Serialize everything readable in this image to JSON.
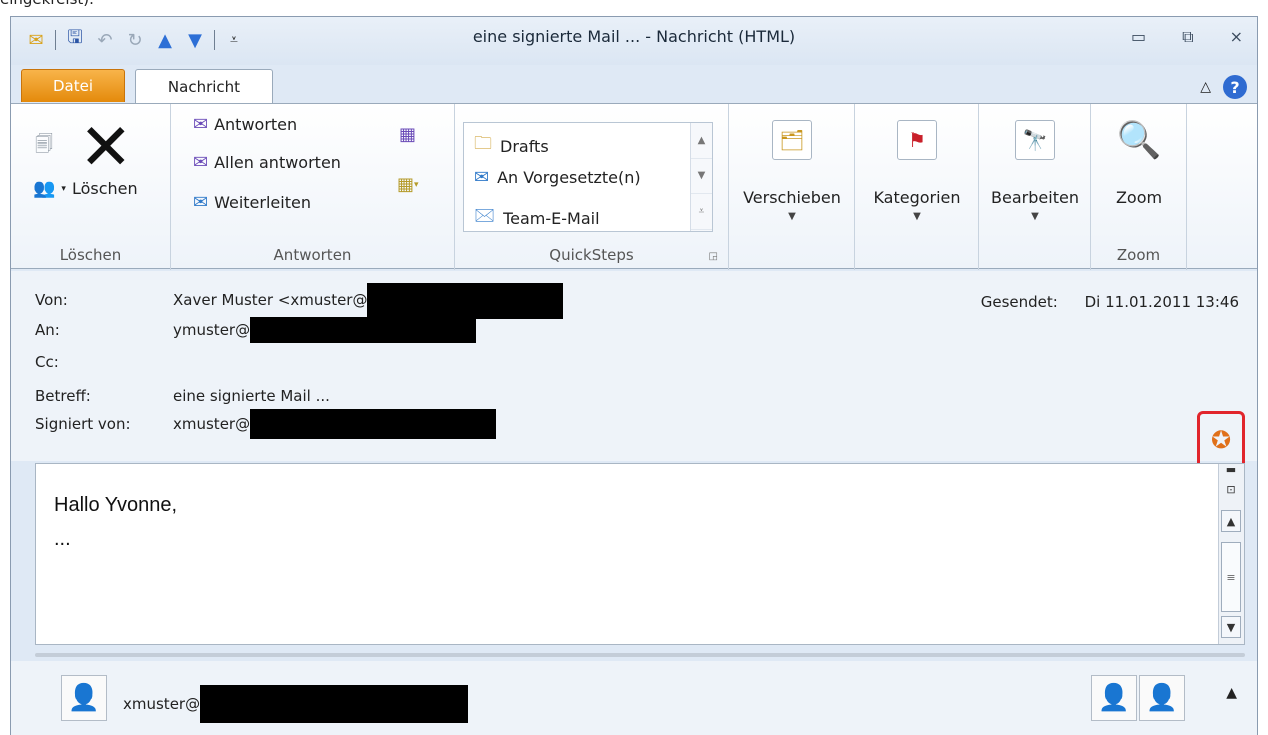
{
  "top_crop_text": "eingekreist).",
  "window": {
    "title": "eine signierte Mail ... - Nachricht (HTML)",
    "controls": {
      "minimize_icon": "minimize-icon",
      "restore_icon": "restore-icon",
      "close_icon": "close-icon"
    }
  },
  "quick_access": [
    "mail-icon",
    "save-icon",
    "undo-icon",
    "redo-icon",
    "up-arrow-icon",
    "down-arrow-icon",
    "customize-icon"
  ],
  "tabs": {
    "datei": "Datei",
    "nachricht": "Nachricht"
  },
  "ribbon": {
    "loeschen_group": {
      "label": "Löschen",
      "delete_label": "Löschen"
    },
    "antworten_group": {
      "label": "Antworten",
      "reply": "Antworten",
      "reply_all": "Allen antworten",
      "forward": "Weiterleiten"
    },
    "quicksteps_group": {
      "label": "QuickSteps",
      "items": [
        "Drafts",
        "An Vorgesetzte(n)",
        "Team-E-Mail"
      ]
    },
    "verschieben": "Verschieben",
    "kategorien": "Kategorien",
    "bearbeiten": "Bearbeiten",
    "zoom_group": {
      "label": "Zoom",
      "button": "Zoom"
    }
  },
  "header": {
    "von_label": "Von:",
    "von_value": "Xaver Muster <xmuster@",
    "an_label": "An:",
    "an_value": "ymuster@",
    "cc_label": "Cc:",
    "betreff_label": "Betreff:",
    "betreff_value": "eine signierte Mail ...",
    "signiert_label": "Signiert von:",
    "signiert_value": "xmuster@",
    "gesendet_label": "Gesendet:",
    "gesendet_value": "Di 11.01.2011 13:46"
  },
  "body": {
    "line1": "Hallo Yvonne,",
    "line2": "..."
  },
  "people_pane": {
    "name": "xmuster@"
  },
  "colors": {
    "highlight_border": "#e1252c",
    "datei_tab": "#e48a0b",
    "help": "#2f6bd1"
  }
}
